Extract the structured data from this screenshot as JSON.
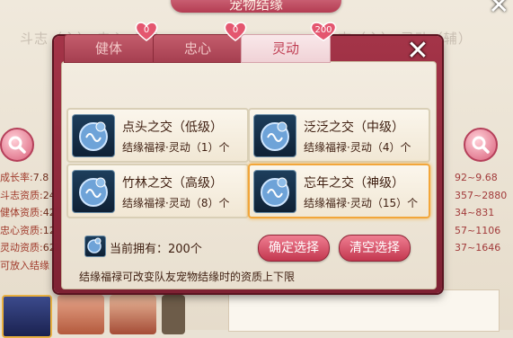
{
  "background": {
    "title": "宠物结缘",
    "left_subtitle": "斗志（主） 忠心（辅）",
    "right_subtitle": "斗志（主） 灵动（辅）",
    "left_stats": [
      {
        "label": "成长率:",
        "value": "7.8"
      },
      {
        "label": "斗志资质:",
        "value": "24"
      },
      {
        "label": "健体资质:",
        "value": "42"
      },
      {
        "label": "忠心资质:",
        "value": "12"
      },
      {
        "label": "灵动资质:",
        "value": "62"
      }
    ],
    "left_bottom_text": "可放入结缘",
    "right_stats": [
      "92~9.68",
      "357~2880",
      "34~831",
      "57~1106",
      "37~1646"
    ]
  },
  "dialog": {
    "tabs": [
      {
        "label": "健体",
        "badge": "0",
        "active": false
      },
      {
        "label": "忠心",
        "badge": "0",
        "active": false
      },
      {
        "label": "灵动",
        "badge": "200",
        "active": true
      }
    ],
    "items": [
      {
        "name": "点头之交（低级）",
        "requirement": "结缘福禄·灵动（1）个",
        "selected": false
      },
      {
        "name": "泛泛之交（中级）",
        "requirement": "结缘福禄·灵动（4）个",
        "selected": false
      },
      {
        "name": "竹林之交（高级）",
        "requirement": "结缘福禄·灵动（8）个",
        "selected": false
      },
      {
        "name": "忘年之交（神级）",
        "requirement": "结缘福禄·灵动（15）个",
        "selected": true
      }
    ],
    "owned_label": "当前拥有：200个",
    "confirm_label": "确定选择",
    "clear_label": "清空选择",
    "hint": "结缘福禄可改变队友宠物结缘时的资质上下限"
  },
  "colors": {
    "accent": "#b43c52",
    "selected_border": "#f2a63a"
  }
}
